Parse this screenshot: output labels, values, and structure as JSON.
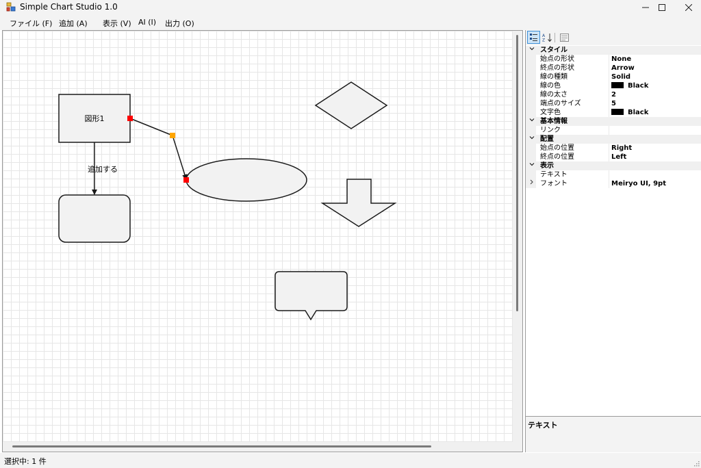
{
  "window": {
    "title": "Simple Chart Studio 1.0",
    "icons": [
      "app-icon",
      "minimize-icon",
      "maximize-icon",
      "close-icon"
    ]
  },
  "menu": [
    {
      "label": "ファイル (F)"
    },
    {
      "label": "追加 (A)"
    },
    {
      "label": "表示 (V)"
    },
    {
      "label": "AI (I)"
    },
    {
      "label": "出力 (O)"
    }
  ],
  "canvas": {
    "shapes": {
      "rect_label": "図形1",
      "connector_label": "追加する"
    },
    "colors": {
      "shape_fill": "#f2f2f2",
      "shape_stroke": "#1a1a1a",
      "handle_red": "#ff0000",
      "handle_orange": "#ffa500"
    }
  },
  "properties": {
    "toolbar_icons": [
      "categorized-icon",
      "alphabetical-icon",
      "property-pages-icon"
    ],
    "categories": [
      {
        "name": "スタイル",
        "rows": [
          {
            "label": "始点の形状",
            "value": "None"
          },
          {
            "label": "終点の形状",
            "value": "Arrow"
          },
          {
            "label": "線の種類",
            "value": "Solid"
          },
          {
            "label": "線の色",
            "value": "Black",
            "swatch": "#000000"
          },
          {
            "label": "線の太さ",
            "value": "2"
          },
          {
            "label": "端点のサイズ",
            "value": "5"
          },
          {
            "label": "文字色",
            "value": "Black",
            "swatch": "#000000"
          }
        ]
      },
      {
        "name": "基本情報",
        "rows": [
          {
            "label": "リンク",
            "value": ""
          }
        ]
      },
      {
        "name": "配置",
        "rows": [
          {
            "label": "始点の位置",
            "value": "Right"
          },
          {
            "label": "終点の位置",
            "value": "Left"
          }
        ]
      },
      {
        "name": "表示",
        "rows": [
          {
            "label": "テキスト",
            "value": ""
          },
          {
            "label": "フォント",
            "value": "Meiryo UI, 9pt",
            "expandable": true
          }
        ]
      }
    ],
    "description_title": "テキスト"
  },
  "status": {
    "text": "選択中: 1 件"
  }
}
